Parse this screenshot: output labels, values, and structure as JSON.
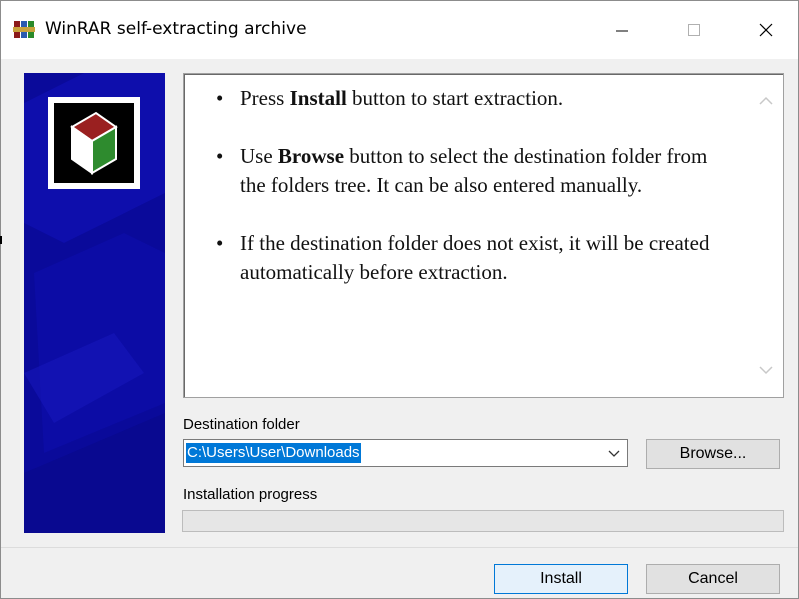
{
  "window": {
    "title": "WinRAR self-extracting archive",
    "app_icon": "winrar-books-icon",
    "controls": {
      "minimize": "minimize-icon",
      "maximize": "maximize-icon",
      "close": "close-icon"
    }
  },
  "info": {
    "bullet_symbol": "•",
    "bullets": [
      {
        "before": "Press ",
        "bold": "Install",
        "after": " button to start extraction."
      },
      {
        "before": "Use ",
        "bold": "Browse",
        "after": " button to select the destination folder from the folders tree. It can be also entered manually."
      },
      {
        "before": "",
        "bold": "",
        "after": "If the destination folder does not exist, it will be created automatically before extraction."
      }
    ]
  },
  "destination": {
    "label": "Destination folder",
    "value": "C:\\Users\\User\\Downloads",
    "browse_label": "Browse..."
  },
  "progress": {
    "label": "Installation progress",
    "fraction": 0
  },
  "buttons": {
    "install_label": "Install",
    "cancel_label": "Cancel"
  },
  "colors": {
    "sidebar": "#0a0a9a",
    "selection": "#0078d7",
    "default_button_border": "#0078d7"
  }
}
